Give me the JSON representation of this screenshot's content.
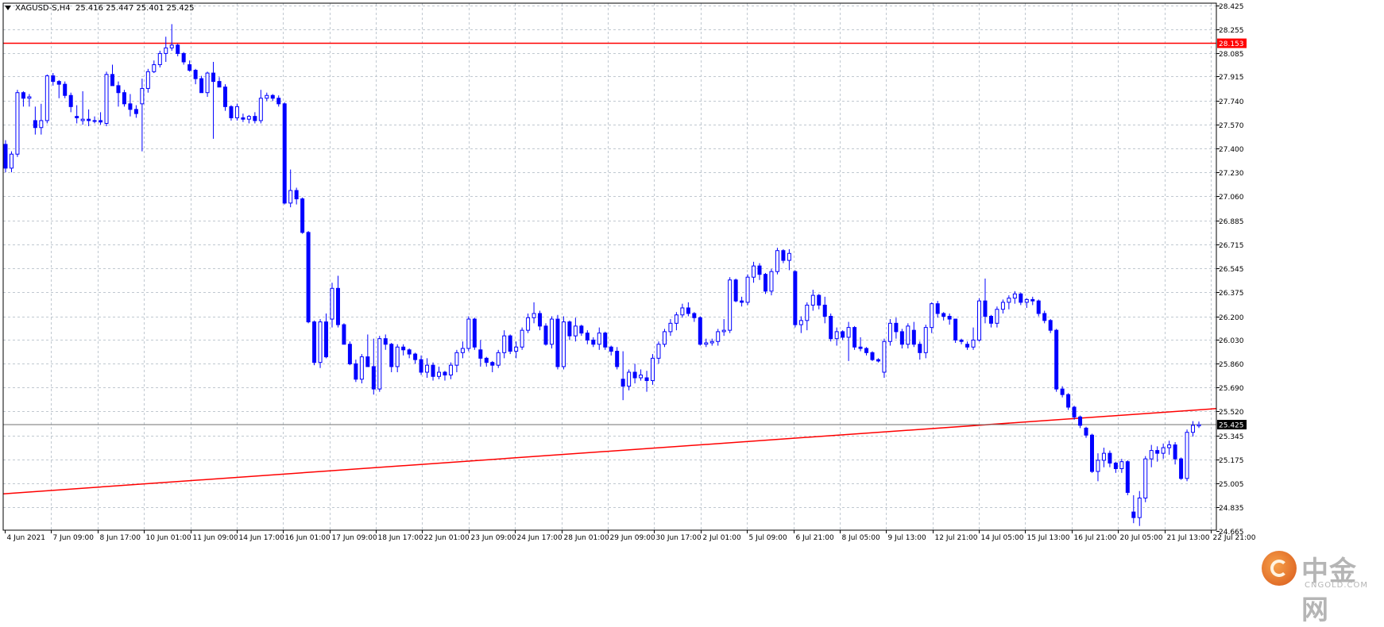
{
  "header": {
    "symbol": "XAGUSD-S,H4",
    "ohlc": "25.416 25.447 25.401 25.425"
  },
  "colors": {
    "candle": "#0000ff",
    "resistance_line": "#ff0000",
    "trend_line": "#ff0000",
    "grid": "#c0c8d0",
    "price_tag_bg": "#ff0000"
  },
  "watermark": {
    "brand": "中金网",
    "site": "CNGOLD.COM"
  },
  "chart_data": {
    "type": "candlestick",
    "symbol": "XAGUSD-S",
    "timeframe": "H4",
    "ylim": [
      24.67,
      28.44
    ],
    "y_ticks": [
      "28.425",
      "28.255",
      "28.085",
      "27.915",
      "27.740",
      "27.570",
      "27.400",
      "27.230",
      "27.060",
      "26.885",
      "26.715",
      "26.545",
      "26.375",
      "26.200",
      "26.030",
      "25.860",
      "25.690",
      "25.520",
      "25.345",
      "25.175",
      "25.005",
      "24.835",
      "24.665"
    ],
    "x_ticks": [
      "4 Jun 2021",
      "7 Jun 09:00",
      "8 Jun 17:00",
      "10 Jun 01:00",
      "11 Jun 09:00",
      "14 Jun 17:00",
      "16 Jun 01:00",
      "17 Jun 09:00",
      "18 Jun 17:00",
      "22 Jun 01:00",
      "23 Jun 09:00",
      "24 Jun 17:00",
      "28 Jun 01:00",
      "29 Jun 09:00",
      "30 Jun 17:00",
      "2 Jul 01:00",
      "5 Jul 09:00",
      "6 Jul 21:00",
      "8 Jul 05:00",
      "9 Jul 13:00",
      "12 Jul 21:00",
      "14 Jul 05:00",
      "15 Jul 13:00",
      "16 Jul 21:00",
      "20 Jul 05:00",
      "21 Jul 13:00",
      "22 Jul 21:00"
    ],
    "grid": true,
    "current_price": "25.425",
    "horizontal_line": {
      "price": "28.153"
    },
    "trend_line": {
      "start_price": 24.93,
      "end_price": 25.54
    },
    "candles": [
      [
        27.43,
        27.46,
        27.23,
        27.26
      ],
      [
        27.26,
        27.38,
        27.23,
        27.36
      ],
      [
        27.36,
        27.82,
        27.34,
        27.8
      ],
      [
        27.8,
        27.81,
        27.7,
        27.76
      ],
      [
        27.76,
        27.79,
        27.7,
        27.77
      ],
      [
        27.6,
        27.7,
        27.5,
        27.55
      ],
      [
        27.55,
        27.72,
        27.5,
        27.6
      ],
      [
        27.6,
        27.93,
        27.58,
        27.92
      ],
      [
        27.92,
        27.94,
        27.85,
        27.88
      ],
      [
        27.88,
        27.89,
        27.76,
        27.86
      ],
      [
        27.86,
        27.88,
        27.76,
        27.78
      ],
      [
        27.78,
        27.8,
        27.66,
        27.7
      ],
      [
        27.63,
        27.71,
        27.58,
        27.62
      ],
      [
        27.6,
        27.81,
        27.57,
        27.61
      ],
      [
        27.61,
        27.68,
        27.56,
        27.6
      ],
      [
        27.6,
        27.63,
        27.58,
        27.6
      ],
      [
        27.6,
        27.66,
        27.57,
        27.59
      ],
      [
        27.58,
        27.95,
        27.56,
        27.93
      ],
      [
        27.93,
        28.0,
        27.85,
        27.85
      ],
      [
        27.85,
        27.88,
        27.7,
        27.8
      ],
      [
        27.8,
        27.82,
        27.7,
        27.72
      ],
      [
        27.72,
        27.79,
        27.63,
        27.68
      ],
      [
        27.68,
        27.71,
        27.62,
        27.65
      ],
      [
        27.72,
        27.9,
        27.38,
        27.83
      ],
      [
        27.83,
        27.97,
        27.8,
        27.95
      ],
      [
        27.95,
        28.03,
        27.94,
        28.0
      ],
      [
        28.0,
        28.1,
        27.98,
        28.08
      ],
      [
        28.08,
        28.2,
        28.02,
        28.12
      ],
      [
        28.12,
        28.29,
        28.1,
        28.14
      ],
      [
        28.14,
        28.15,
        28.06,
        28.08
      ],
      [
        28.08,
        28.09,
        28.0,
        28.02
      ],
      [
        28.0,
        28.03,
        27.95,
        27.96
      ],
      [
        27.96,
        27.97,
        27.86,
        27.9
      ],
      [
        27.9,
        27.92,
        27.8,
        27.8
      ],
      [
        27.8,
        27.95,
        27.77,
        27.94
      ],
      [
        27.94,
        28.02,
        27.47,
        27.88
      ],
      [
        27.88,
        27.91,
        27.84,
        27.84
      ],
      [
        27.84,
        27.86,
        27.67,
        27.7
      ],
      [
        27.7,
        27.71,
        27.6,
        27.62
      ],
      [
        27.62,
        27.72,
        27.6,
        27.7
      ],
      [
        27.62,
        27.65,
        27.59,
        27.61
      ],
      [
        27.61,
        27.64,
        27.58,
        27.63
      ],
      [
        27.63,
        27.66,
        27.58,
        27.6
      ],
      [
        27.6,
        27.82,
        27.58,
        27.76
      ],
      [
        27.76,
        27.8,
        27.74,
        27.78
      ],
      [
        27.78,
        27.79,
        27.74,
        27.76
      ],
      [
        27.76,
        27.78,
        27.7,
        27.72
      ],
      [
        27.72,
        27.73,
        27.0,
        27.01
      ],
      [
        27.01,
        27.25,
        26.98,
        27.1
      ],
      [
        27.1,
        27.12,
        27.0,
        27.04
      ],
      [
        27.04,
        27.05,
        26.79,
        26.8
      ],
      [
        26.8,
        26.81,
        26.15,
        26.16
      ],
      [
        26.16,
        26.17,
        25.85,
        25.87
      ],
      [
        25.87,
        26.18,
        25.83,
        26.16
      ],
      [
        26.16,
        26.22,
        25.9,
        25.91
      ],
      [
        26.18,
        26.44,
        26.12,
        26.4
      ],
      [
        26.4,
        26.49,
        26.12,
        26.14
      ],
      [
        26.14,
        26.15,
        26.0,
        26.0
      ],
      [
        26.0,
        26.02,
        25.85,
        25.86
      ],
      [
        25.86,
        25.89,
        25.73,
        25.75
      ],
      [
        25.75,
        25.93,
        25.72,
        25.91
      ],
      [
        25.91,
        26.07,
        25.84,
        25.84
      ],
      [
        25.84,
        26.04,
        25.64,
        25.68
      ],
      [
        25.68,
        26.06,
        25.66,
        26.04
      ],
      [
        26.04,
        26.07,
        25.96,
        26.0
      ],
      [
        26.0,
        26.01,
        25.8,
        25.84
      ],
      [
        25.84,
        26.0,
        25.8,
        25.98
      ],
      [
        25.98,
        26.0,
        25.92,
        25.96
      ],
      [
        25.96,
        25.97,
        25.9,
        25.93
      ],
      [
        25.93,
        25.94,
        25.86,
        25.89
      ],
      [
        25.89,
        25.92,
        25.78,
        25.8
      ],
      [
        25.8,
        25.9,
        25.76,
        25.85
      ],
      [
        25.85,
        25.87,
        25.74,
        25.77
      ],
      [
        25.77,
        25.84,
        25.75,
        25.8
      ],
      [
        25.8,
        25.81,
        25.74,
        25.78
      ],
      [
        25.78,
        25.87,
        25.75,
        25.85
      ],
      [
        25.85,
        25.96,
        25.8,
        25.94
      ],
      [
        25.94,
        26.02,
        25.9,
        25.97
      ],
      [
        25.97,
        26.2,
        25.95,
        26.18
      ],
      [
        26.18,
        26.19,
        25.96,
        25.98
      ],
      [
        25.96,
        26.03,
        25.84,
        25.9
      ],
      [
        25.9,
        25.91,
        25.84,
        25.87
      ],
      [
        25.87,
        25.88,
        25.8,
        25.85
      ],
      [
        25.85,
        25.96,
        25.83,
        25.94
      ],
      [
        25.94,
        26.1,
        25.9,
        26.06
      ],
      [
        26.06,
        26.07,
        25.93,
        25.95
      ],
      [
        25.95,
        26.02,
        25.9,
        25.98
      ],
      [
        25.98,
        26.12,
        25.96,
        26.1
      ],
      [
        26.1,
        26.22,
        26.08,
        26.19
      ],
      [
        26.19,
        26.3,
        26.15,
        26.22
      ],
      [
        26.22,
        26.24,
        26.1,
        26.13
      ],
      [
        26.13,
        26.15,
        25.99,
        26.0
      ],
      [
        26.0,
        26.2,
        25.97,
        26.18
      ],
      [
        26.18,
        26.21,
        25.82,
        25.84
      ],
      [
        25.84,
        26.2,
        25.82,
        26.16
      ],
      [
        26.16,
        26.17,
        26.03,
        26.06
      ],
      [
        26.06,
        26.19,
        26.02,
        26.13
      ],
      [
        26.13,
        26.14,
        26.06,
        26.08
      ],
      [
        26.08,
        26.1,
        26.0,
        26.03
      ],
      [
        26.03,
        26.05,
        25.98,
        26.0
      ],
      [
        26.0,
        26.12,
        25.96,
        26.08
      ],
      [
        26.08,
        26.09,
        25.96,
        25.98
      ],
      [
        25.98,
        25.99,
        25.92,
        25.95
      ],
      [
        25.95,
        25.98,
        25.82,
        25.84
      ],
      [
        25.75,
        25.95,
        25.6,
        25.7
      ],
      [
        25.7,
        25.82,
        25.67,
        25.8
      ],
      [
        25.8,
        25.86,
        25.72,
        25.76
      ],
      [
        25.76,
        25.82,
        25.74,
        25.78
      ],
      [
        25.76,
        25.81,
        25.66,
        25.74
      ],
      [
        25.74,
        25.93,
        25.71,
        25.9
      ],
      [
        25.9,
        26.02,
        25.86,
        26.0
      ],
      [
        26.0,
        26.11,
        25.98,
        26.09
      ],
      [
        26.09,
        26.18,
        26.06,
        26.15
      ],
      [
        26.15,
        26.23,
        26.1,
        26.21
      ],
      [
        26.21,
        26.29,
        26.19,
        26.26
      ],
      [
        26.26,
        26.3,
        26.2,
        26.22
      ],
      [
        26.22,
        26.23,
        26.16,
        26.19
      ],
      [
        26.19,
        26.2,
        25.99,
        26.0
      ],
      [
        26.0,
        26.04,
        25.98,
        26.01
      ],
      [
        26.01,
        26.04,
        25.99,
        26.02
      ],
      [
        26.02,
        26.11,
        25.99,
        26.09
      ],
      [
        26.09,
        26.18,
        26.06,
        26.1
      ],
      [
        26.1,
        26.48,
        26.08,
        26.46
      ],
      [
        26.46,
        26.47,
        26.3,
        26.31
      ],
      [
        26.31,
        26.34,
        26.27,
        26.3
      ],
      [
        26.3,
        26.5,
        26.28,
        26.48
      ],
      [
        26.48,
        26.59,
        26.44,
        26.56
      ],
      [
        26.56,
        26.58,
        26.46,
        26.5
      ],
      [
        26.5,
        26.51,
        26.36,
        26.38
      ],
      [
        26.38,
        26.54,
        26.35,
        26.52
      ],
      [
        26.52,
        26.69,
        26.5,
        26.67
      ],
      [
        26.67,
        26.68,
        26.58,
        26.6
      ],
      [
        26.6,
        26.68,
        26.53,
        26.65
      ],
      [
        26.52,
        26.53,
        26.12,
        26.14
      ],
      [
        26.14,
        26.2,
        26.08,
        26.17
      ],
      [
        26.17,
        26.3,
        26.1,
        26.28
      ],
      [
        26.28,
        26.39,
        26.24,
        26.35
      ],
      [
        26.35,
        26.36,
        26.25,
        26.28
      ],
      [
        26.28,
        26.34,
        26.15,
        26.2
      ],
      [
        26.2,
        26.22,
        26.02,
        26.04
      ],
      [
        26.04,
        26.12,
        25.99,
        26.09
      ],
      [
        26.09,
        26.1,
        26.03,
        26.05
      ],
      [
        26.05,
        26.16,
        25.88,
        26.12
      ],
      [
        26.12,
        26.13,
        25.96,
        25.98
      ],
      [
        25.98,
        26.05,
        25.95,
        25.97
      ],
      [
        25.97,
        25.98,
        25.92,
        25.94
      ],
      [
        25.94,
        25.95,
        25.88,
        25.89
      ],
      [
        25.89,
        25.9,
        25.87,
        25.88
      ],
      [
        25.8,
        26.04,
        25.76,
        26.02
      ],
      [
        26.02,
        26.18,
        25.99,
        26.15
      ],
      [
        26.15,
        26.19,
        26.04,
        26.09
      ],
      [
        26.09,
        26.11,
        25.97,
        26.0
      ],
      [
        26.0,
        26.15,
        25.97,
        26.13
      ],
      [
        26.1,
        26.16,
        25.98,
        26.0
      ],
      [
        26.0,
        26.02,
        25.89,
        25.94
      ],
      [
        25.94,
        26.14,
        25.9,
        26.12
      ],
      [
        26.12,
        26.3,
        26.08,
        26.29
      ],
      [
        26.29,
        26.31,
        26.19,
        26.22
      ],
      [
        26.22,
        26.23,
        26.17,
        26.2
      ],
      [
        26.2,
        26.22,
        26.14,
        26.18
      ],
      [
        26.18,
        26.18,
        26.01,
        26.03
      ],
      [
        26.03,
        26.04,
        26.0,
        26.02
      ],
      [
        26.0,
        26.02,
        25.96,
        25.98
      ],
      [
        25.98,
        26.12,
        25.96,
        26.03
      ],
      [
        26.03,
        26.33,
        26.02,
        26.31
      ],
      [
        26.31,
        26.47,
        26.15,
        26.2
      ],
      [
        26.2,
        26.21,
        26.12,
        26.15
      ],
      [
        26.15,
        26.27,
        26.12,
        26.25
      ],
      [
        26.25,
        26.32,
        26.22,
        26.3
      ],
      [
        26.3,
        26.35,
        26.25,
        26.33
      ],
      [
        26.33,
        26.38,
        26.29,
        26.36
      ],
      [
        26.36,
        26.37,
        26.28,
        26.3
      ],
      [
        26.3,
        26.33,
        26.26,
        26.32
      ],
      [
        26.32,
        26.34,
        26.28,
        26.31
      ],
      [
        26.31,
        26.32,
        26.2,
        26.22
      ],
      [
        26.22,
        26.24,
        26.15,
        26.17
      ],
      [
        26.17,
        26.18,
        26.08,
        26.1
      ],
      [
        26.1,
        26.11,
        25.66,
        25.68
      ],
      [
        25.68,
        25.7,
        25.62,
        25.64
      ],
      [
        25.64,
        25.65,
        25.53,
        25.55
      ],
      [
        25.55,
        25.56,
        25.46,
        25.48
      ],
      [
        25.48,
        25.49,
        25.4,
        25.42
      ],
      [
        25.4,
        25.41,
        25.33,
        25.35
      ],
      [
        25.35,
        25.36,
        25.08,
        25.09
      ],
      [
        25.09,
        25.22,
        25.02,
        25.17
      ],
      [
        25.17,
        25.26,
        25.12,
        25.22
      ],
      [
        25.22,
        25.24,
        25.12,
        25.15
      ],
      [
        25.15,
        25.16,
        25.08,
        25.11
      ],
      [
        25.11,
        25.18,
        25.08,
        25.16
      ],
      [
        25.16,
        25.17,
        24.92,
        24.94
      ],
      [
        24.8,
        24.92,
        24.72,
        24.76
      ],
      [
        24.76,
        24.95,
        24.7,
        24.9
      ],
      [
        24.9,
        25.2,
        24.87,
        25.18
      ],
      [
        25.18,
        25.28,
        25.12,
        25.24
      ],
      [
        25.24,
        25.27,
        25.16,
        25.22
      ],
      [
        25.22,
        25.29,
        25.18,
        25.26
      ],
      [
        25.26,
        25.31,
        25.21,
        25.28
      ],
      [
        25.28,
        25.3,
        25.14,
        25.18
      ],
      [
        25.18,
        25.19,
        25.03,
        25.04
      ],
      [
        25.04,
        25.39,
        25.02,
        25.37
      ],
      [
        25.37,
        25.45,
        25.34,
        25.42
      ],
      [
        25.416,
        25.447,
        25.401,
        25.425
      ]
    ]
  }
}
